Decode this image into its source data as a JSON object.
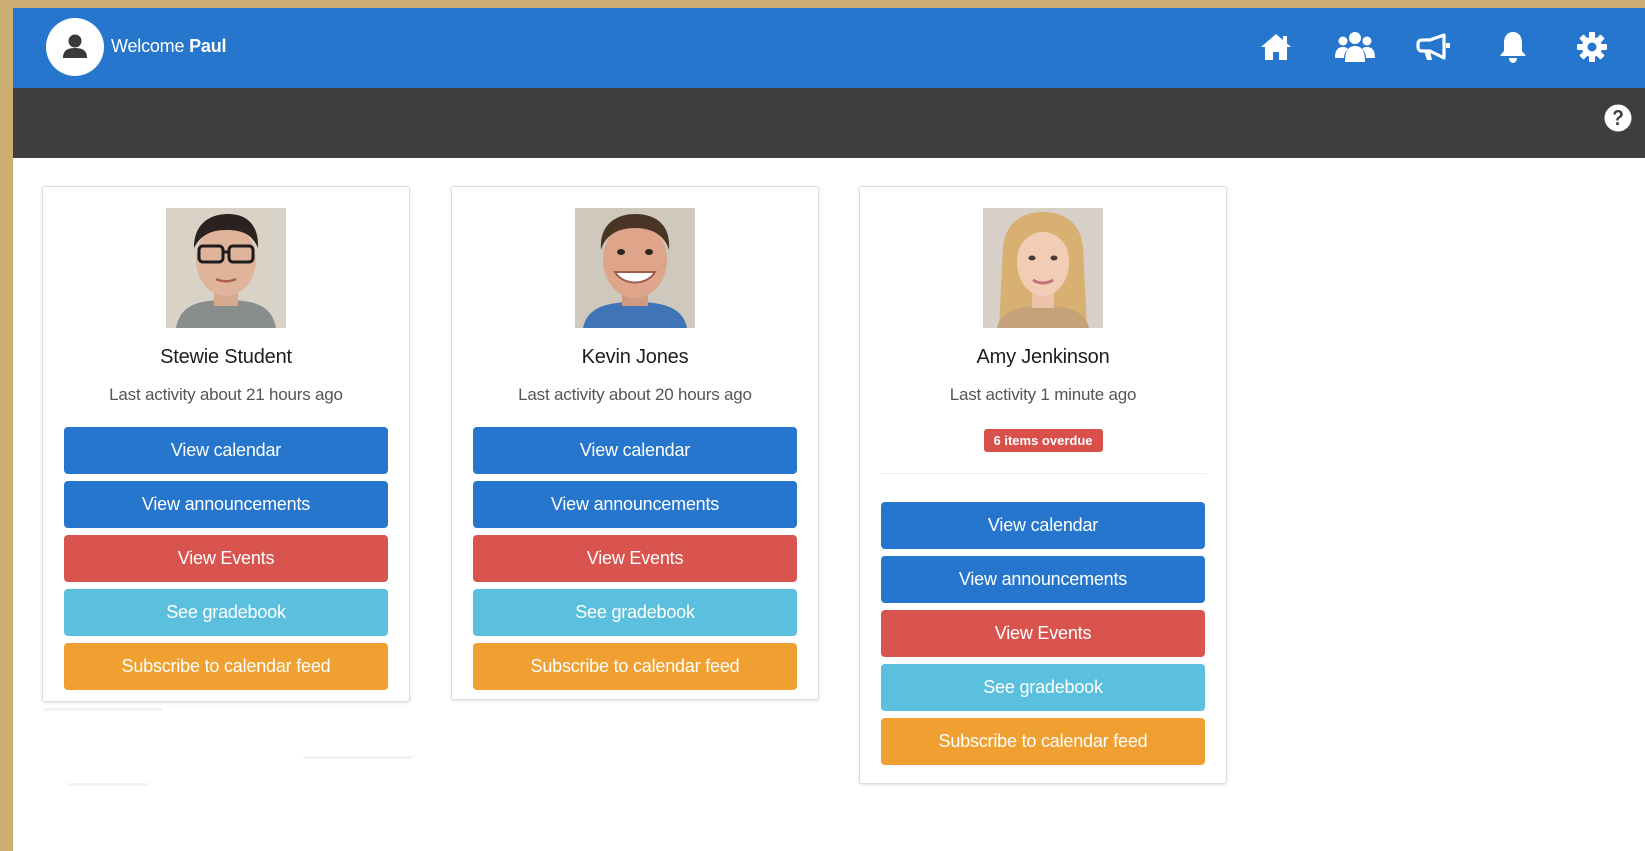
{
  "header": {
    "welcome_prefix": "Welcome",
    "user_name": "Paul",
    "nav_icons": [
      "home-icon",
      "users-icon",
      "megaphone-icon",
      "bell-icon",
      "gear-icon"
    ]
  },
  "subbar": {
    "help_icon": "question-circle-icon"
  },
  "colors": {
    "topbar": "#2576cc",
    "subbar": "#3e3e3e",
    "primary": "#2576cc",
    "danger": "#d9534f",
    "info": "#5bc0de",
    "warning": "#f0a030",
    "page_border": "#ccae72"
  },
  "students": [
    {
      "name": "Stewie Student",
      "activity": "Last activity about 21 hours ago",
      "badge": "",
      "buttons": {
        "calendar": "View calendar",
        "announcements": "View announcements",
        "events": "View Events",
        "gradebook": "See gradebook",
        "subscribe": "Subscribe to calendar feed"
      }
    },
    {
      "name": "Kevin Jones",
      "activity": "Last activity about 20 hours ago",
      "badge": "",
      "buttons": {
        "calendar": "View calendar",
        "announcements": "View announcements",
        "events": "View Events",
        "gradebook": "See gradebook",
        "subscribe": "Subscribe to calendar feed"
      }
    },
    {
      "name": "Amy Jenkinson",
      "activity": "Last activity 1 minute ago",
      "badge": "6 items overdue",
      "buttons": {
        "calendar": "View calendar",
        "announcements": "View announcements",
        "events": "View Events",
        "gradebook": "See gradebook",
        "subscribe": "Subscribe to calendar feed"
      }
    }
  ]
}
